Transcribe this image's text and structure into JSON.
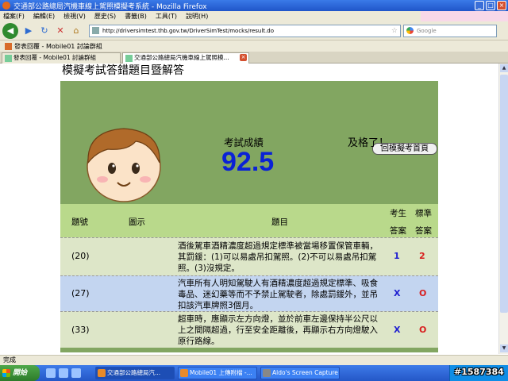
{
  "window": {
    "title": "交通部公路總局汽機車線上駕照模擬考系統 - Mozilla Firefox"
  },
  "menu": {
    "items": [
      "檔案(F)",
      "編輯(E)",
      "檢視(V)",
      "歷史(S)",
      "書籤(B)",
      "工具(T)",
      "說明(H)"
    ]
  },
  "nav": {
    "url": "http://driversimtest.thb.gov.tw/DriverSimTest/mocks/result.do",
    "search_placeholder": "Google"
  },
  "bookmarks": {
    "item": "發表回覆 - Mobile01 討論群組"
  },
  "tabs": [
    {
      "label": "發表回覆 - Mobile01 討論群組"
    },
    {
      "label": "交通部公路總局汽機車線上駕照模..."
    }
  ],
  "page": {
    "title": "模擬考試答錯題目暨解答",
    "home_button": "回模擬考首頁",
    "score_label": "考試成績",
    "score_value": "92.5",
    "pass_label": "及格了！",
    "headers": {
      "number": "題號",
      "image": "圖示",
      "question": "題目",
      "your_answer_1": "考生",
      "your_answer_2": "答案",
      "standard_1": "標準",
      "standard_2": "答案"
    },
    "questions": [
      {
        "number": "(20)",
        "text": "酒後駕車酒精濃度超過規定標準被當場移置保管車輛，其罰鍰：(1)可以易處吊扣駕照。(2)不可以易處吊扣駕照。(3)沒規定。",
        "answer": "1",
        "standard": "2"
      },
      {
        "number": "(27)",
        "text": "汽車所有人明知駕駛人有酒精濃度超過規定標準、吸食毒品、迷幻藥等而不予禁止駕駛者，除處罰鍰外，並吊扣該汽車牌照3個月。",
        "answer": "X",
        "standard": "O"
      },
      {
        "number": "(33)",
        "text": "超車時，應顯示左方向燈，並於前車左邊保持半公尺以上之間隔超過，行至安全距離後，再顯示右方向燈駛入原行路線。",
        "answer": "X",
        "standard": "O"
      }
    ]
  },
  "status": {
    "text": "完成"
  },
  "taskbar": {
    "start": "開始",
    "tasks": [
      {
        "label": "交通部公路總局汽..."
      },
      {
        "label": "Mobile01 上傳附檔 -..."
      },
      {
        "label": "Aldo's Screen Capture ..."
      }
    ]
  },
  "watermark": "#1587384",
  "colors": {
    "panel_green": "#82a661",
    "header_green": "#b9d98b",
    "row_light": "#dde6c8",
    "row_blue": "#c3d5f0",
    "score_blue": "#0a22d6",
    "standard_red": "#d81e1e"
  }
}
